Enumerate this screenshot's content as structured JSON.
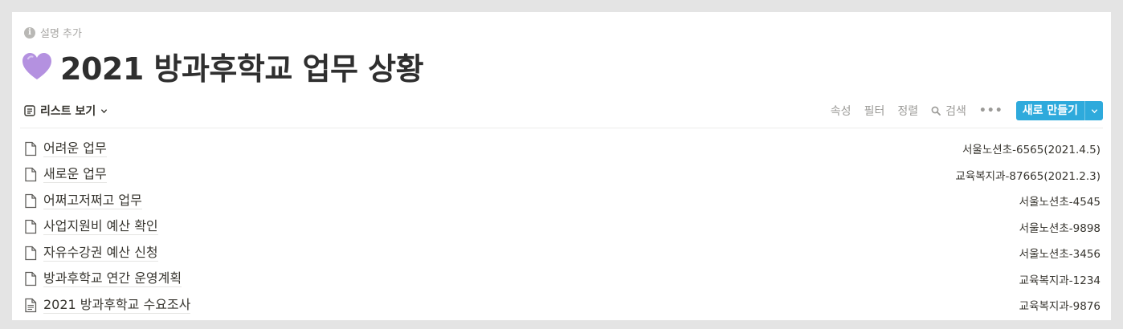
{
  "header": {
    "description_placeholder": "설명 추가",
    "title": "2021 방과후학교 업무 상황",
    "emoji_icon": "purple-heart-icon"
  },
  "toolbar": {
    "view_label": "리스트 보기",
    "properties_label": "속성",
    "filter_label": "필터",
    "sort_label": "정렬",
    "search_label": "검색",
    "new_button_label": "새로 만들기"
  },
  "colors": {
    "accent": "#2eaadc",
    "heart": "#b491e0"
  },
  "rows": [
    {
      "title": "어려운 업무",
      "property": "서울노션초-6565(2021.4.5)",
      "icon": "page-icon"
    },
    {
      "title": "새로운 업무",
      "property": "교육복지과-87665(2021.2.3)",
      "icon": "page-icon"
    },
    {
      "title": "어쩌고저쩌고 업무",
      "property": "서울노션초-4545",
      "icon": "page-icon"
    },
    {
      "title": "사업지원비 예산 확인",
      "property": "서울노션초-9898",
      "icon": "page-icon"
    },
    {
      "title": "자유수강권 예산 신청",
      "property": "서울노션초-3456",
      "icon": "page-icon"
    },
    {
      "title": "방과후학교 연간 운영계획",
      "property": "교육복지과-1234",
      "icon": "page-icon"
    },
    {
      "title": "2021 방과후학교 수요조사",
      "property": "교육복지과-9876",
      "icon": "page-text-icon"
    }
  ]
}
